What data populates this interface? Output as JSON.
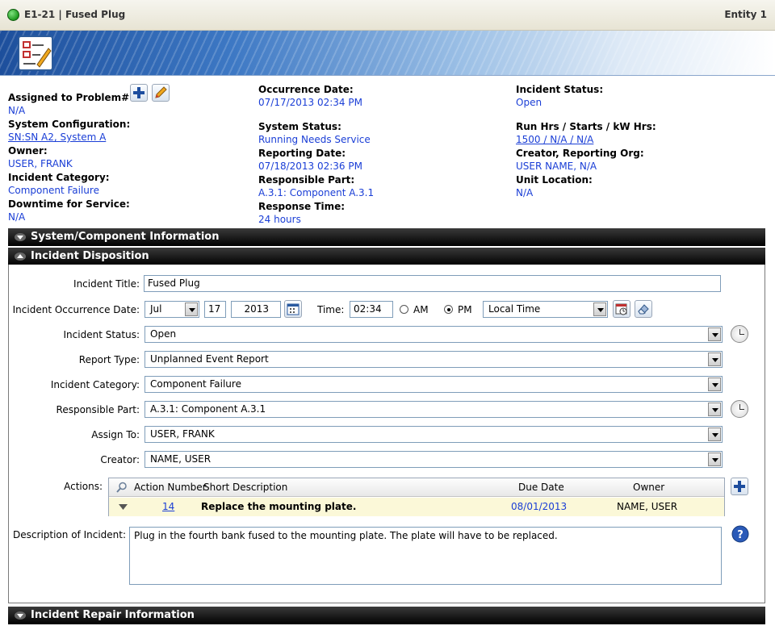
{
  "window": {
    "title": "E1-21 | Fused Plug",
    "entity": "Entity 1",
    "status_color": "#1f9a1f"
  },
  "summary": {
    "assigned_to_problem": {
      "label": "Assigned to Problem#",
      "value": "N/A"
    },
    "occurrence_date": {
      "label": "Occurrence Date:",
      "value": "07/17/2013 02:34 PM"
    },
    "incident_status": {
      "label": "Incident Status:",
      "value": "Open"
    },
    "system_configuration": {
      "label": "System Configuration:",
      "value": "SN:SN A2, System A"
    },
    "system_status": {
      "label": "System Status:",
      "value": "Running Needs Service"
    },
    "run_hrs": {
      "label": "Run Hrs / Starts / kW Hrs:",
      "value": "1500 / N/A / N/A"
    },
    "owner": {
      "label": "Owner:",
      "value": "USER, FRANK"
    },
    "reporting_date": {
      "label": "Reporting Date:",
      "value": "07/18/2013 02:36 PM"
    },
    "creator_org": {
      "label": "Creator, Reporting Org:",
      "value": "USER NAME, N/A"
    },
    "incident_category": {
      "label": "Incident Category:",
      "value": "Component Failure"
    },
    "responsible_part": {
      "label": "Responsible Part:",
      "value": "A.3.1: Component A.3.1"
    },
    "unit_location": {
      "label": "Unit Location:",
      "value": "N/A"
    },
    "downtime": {
      "label": "Downtime for Service:",
      "value": "N/A"
    },
    "response_time": {
      "label": "Response Time:",
      "value": "24 hours"
    }
  },
  "sections": {
    "system_component": "System/Component Information",
    "incident_disposition": "Incident Disposition",
    "incident_repair": "Incident Repair Information"
  },
  "form": {
    "incident_title": {
      "label": "Incident Title:",
      "value": "Fused Plug"
    },
    "occurrence_date": {
      "label": "Incident Occurrence Date:",
      "month": "Jul",
      "day": "17",
      "year": "2013",
      "time_label": "Time:",
      "time": "02:34",
      "am_label": "AM",
      "pm_label": "PM",
      "selected_period": "PM",
      "timezone": "Local Time"
    },
    "incident_status": {
      "label": "Incident Status:",
      "value": "Open"
    },
    "report_type": {
      "label": "Report Type:",
      "value": "Unplanned Event Report"
    },
    "incident_category": {
      "label": "Incident Category:",
      "value": "Component Failure"
    },
    "responsible_part": {
      "label": "Responsible Part:",
      "value": "A.3.1: Component A.3.1"
    },
    "assign_to": {
      "label": "Assign To:",
      "value": "USER, FRANK"
    },
    "creator": {
      "label": "Creator:",
      "value": "NAME, USER"
    },
    "actions": {
      "label": "Actions:",
      "columns": [
        "Action Number",
        "Short Description",
        "Due Date",
        "Owner"
      ],
      "rows": [
        {
          "number": "14",
          "description": "Replace the mounting plate.",
          "due": "08/01/2013",
          "owner": "NAME, USER"
        }
      ]
    },
    "description": {
      "label": "Description of Incident:",
      "value": "Plug in the fourth bank fused to the mounting plate. The plate will have to be replaced."
    }
  }
}
